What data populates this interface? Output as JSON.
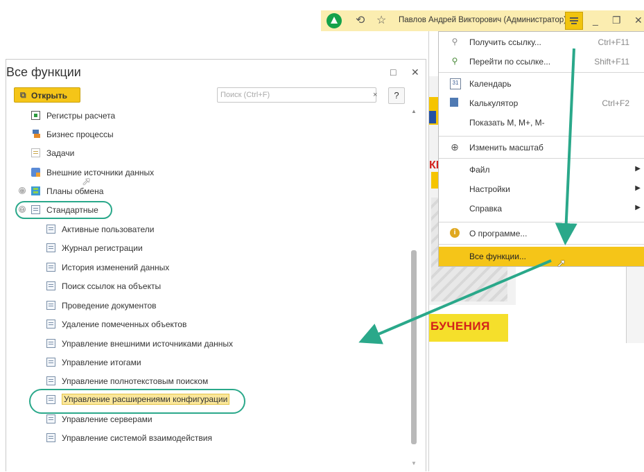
{
  "topbar": {
    "user_name": "Павлов Андрей Викторович (Администратор)",
    "icons": [
      "app-logo-icon",
      "history-icon",
      "star-icon",
      "menu-icon",
      "minimize-icon",
      "restore-icon",
      "close-icon"
    ]
  },
  "background": {
    "text_fragment": "КI",
    "banner_text": "БУЧЕНИЯ"
  },
  "menu": {
    "items": [
      {
        "label": "Получить ссылку...",
        "shortcut": "Ctrl+F11",
        "icon": "link-icon"
      },
      {
        "label": "Перейти по ссылке...",
        "shortcut": "Shift+F11",
        "icon": "go-link-icon"
      },
      {
        "label": "Календарь",
        "shortcut": "",
        "icon": "calendar-icon"
      },
      {
        "label": "Калькулятор",
        "shortcut": "Ctrl+F2",
        "icon": "calculator-icon"
      },
      {
        "label": "Показать М, М+, М-",
        "shortcut": "",
        "icon": ""
      },
      {
        "label": "Изменить масштаб",
        "shortcut": "",
        "icon": "zoom-icon"
      },
      {
        "label": "Файл",
        "shortcut": "",
        "icon": "",
        "submenu": true
      },
      {
        "label": "Настройки",
        "shortcut": "",
        "icon": "",
        "submenu": true
      },
      {
        "label": "Справка",
        "shortcut": "",
        "icon": "",
        "submenu": true
      },
      {
        "label": "О программе...",
        "shortcut": "",
        "icon": "info-icon"
      },
      {
        "label": "Все функции...",
        "shortcut": "",
        "icon": "",
        "active": true
      }
    ]
  },
  "window": {
    "title": "Все функции",
    "open_label": "Открыть",
    "search_placeholder": "Поиск (Ctrl+F)",
    "search_value": "",
    "search_clear": "×",
    "help_label": "?",
    "restore_symbol": "□",
    "close_symbol": "✕",
    "tree": [
      {
        "label": "Регистры расчета",
        "icon": "register-icon",
        "level": 1
      },
      {
        "label": "Бизнес процессы",
        "icon": "business-process-icon",
        "level": 1
      },
      {
        "label": "Задачи",
        "icon": "task-icon",
        "level": 1
      },
      {
        "label": "Внешние источники данных",
        "icon": "external-source-icon",
        "level": 1
      },
      {
        "label": "Планы обмена",
        "icon": "exchange-plan-icon",
        "level": 1,
        "expander": "⊕"
      },
      {
        "label": "Стандартные",
        "icon": "folder-icon",
        "level": 1,
        "expander": "⊖"
      },
      {
        "label": "Активные пользователи",
        "icon": "processing-icon",
        "level": 2
      },
      {
        "label": "Журнал регистрации",
        "icon": "processing-icon",
        "level": 2
      },
      {
        "label": "История изменений данных",
        "icon": "processing-icon",
        "level": 2
      },
      {
        "label": "Поиск ссылок на объекты",
        "icon": "processing-icon",
        "level": 2
      },
      {
        "label": "Проведение документов",
        "icon": "processing-icon",
        "level": 2
      },
      {
        "label": "Удаление помеченных объектов",
        "icon": "processing-icon",
        "level": 2
      },
      {
        "label": "Управление внешними источниками данных",
        "icon": "processing-icon",
        "level": 2
      },
      {
        "label": "Управление итогами",
        "icon": "processing-icon",
        "level": 2
      },
      {
        "label": "Управление полнотекстовым поиском",
        "icon": "processing-icon",
        "level": 2
      },
      {
        "label": "Управление расширениями конфигурации",
        "icon": "processing-icon",
        "level": 2,
        "selected": true
      },
      {
        "label": "Управление серверами",
        "icon": "processing-icon",
        "level": 2
      },
      {
        "label": "Управление системой взаимодействия",
        "icon": "processing-icon",
        "level": 2
      }
    ]
  },
  "colors": {
    "accent": "#f5c518",
    "annotation": "#2aa88a",
    "topbar_bg": "#fbedb0"
  }
}
